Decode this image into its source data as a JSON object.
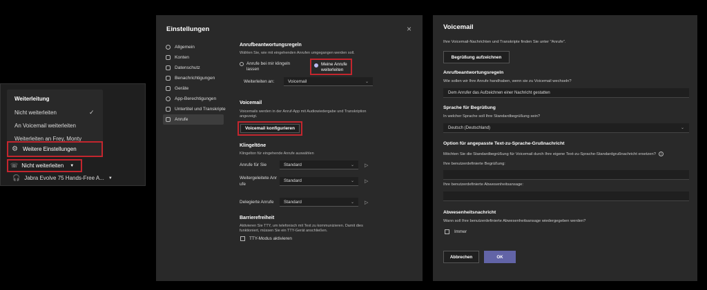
{
  "flyout": {
    "header": "Weiterleitung",
    "items": [
      "Nicht weiterleiten",
      "An Voicemail weiterleiten",
      "Weiterleiten an Frey, Monty"
    ],
    "more_settings": "Weitere Einstellungen",
    "toggle_label": "Nicht weiterleiten",
    "device_label": "Jabra Evolve 75 Hands-Free A..."
  },
  "settings": {
    "title": "Einstellungen",
    "close": "×",
    "nav": [
      "Allgemein",
      "Konten",
      "Datenschutz",
      "Benachrichtigungen",
      "Geräte",
      "App-Berechtigungen",
      "Untertitel und Transkripte",
      "Anrufe"
    ],
    "answer_rules": {
      "title": "Anrufbeantwortungsregeln",
      "desc": "Wählen Sie, wie mit eingehenden Anrufen umgegangen werden soll.",
      "option_ring": "Anrufe bei mir klingeln lassen",
      "option_forward": "Meine Anrufe weiterleiten",
      "forward_to_label": "Weiterleiten an:",
      "forward_to_value": "Voicemail"
    },
    "voicemail": {
      "title": "Voicemail",
      "desc": "Voicemails werden in der Anruf-App mit Audiowiedergabe und Transkription angezeigt.",
      "button": "Voicemail konfigurieren"
    },
    "ringtones": {
      "title": "Klingeltöne",
      "desc": "Klingelton für eingehende Anrufe auswählen",
      "rows": [
        {
          "label": "Anrufe für Sie",
          "value": "Standard"
        },
        {
          "label": "Weitergeleitete Anrufe",
          "value": "Standard"
        },
        {
          "label": "Delegierte Anrufe",
          "value": "Standard"
        }
      ]
    },
    "accessibility": {
      "title": "Barrierefreiheit",
      "desc": "Aktivieren Sie TTY, um telefonisch mit Text zu kommunizieren. Damit dies funktioniert, müssen Sie ein TTY-Gerät anschließen.",
      "tty_label": "TTY-Modus aktivieren"
    }
  },
  "voicemail": {
    "title": "Voicemail",
    "info": "Ihre Voicemail-Nachrichten und Transkripte finden Sie unter \"Anrufe\".",
    "record_button": "Begrüßung aufzeichnen",
    "rules_title": "Anrufbeantwortungsregeln",
    "rules_question": "Wie sollen wir Ihre Anrufe handhaben, wenn sie zu Voicemail wechseln?",
    "rules_value": "Dem Anrufer das Aufzeichnen einer Nachricht gestatten",
    "lang_title": "Sprache für Begrüßung",
    "lang_question": "In welcher Sprache soll Ihre Standardbegrüßung sein?",
    "lang_value": "Deutsch (Deutschland)",
    "tts_title": "Option für angepasste Text-zu-Sprache-Grußnachricht",
    "tts_question": "Möchten Sie die Standardbegrüßung für Voicemail durch Ihre eigene Text-zu-Sprache-Standardgrußnachricht ersetzen?",
    "custom_greeting_label": "Ihre benutzerdefinierte Begrüßung:",
    "custom_absence_label": "Ihre benutzerdefinierte Abwesenheitsansage:",
    "absence_title": "Abwesenheitsnachricht",
    "absence_question": "Wann soll Ihre benutzerdefinierte Abwesenheitsansage wiedergegeben werden?",
    "always_label": "Immer",
    "cancel": "Abbrechen",
    "ok": "OK"
  },
  "colors": {
    "accent": "#6264a7",
    "highlight": "#c4262e",
    "panel": "#292929"
  }
}
